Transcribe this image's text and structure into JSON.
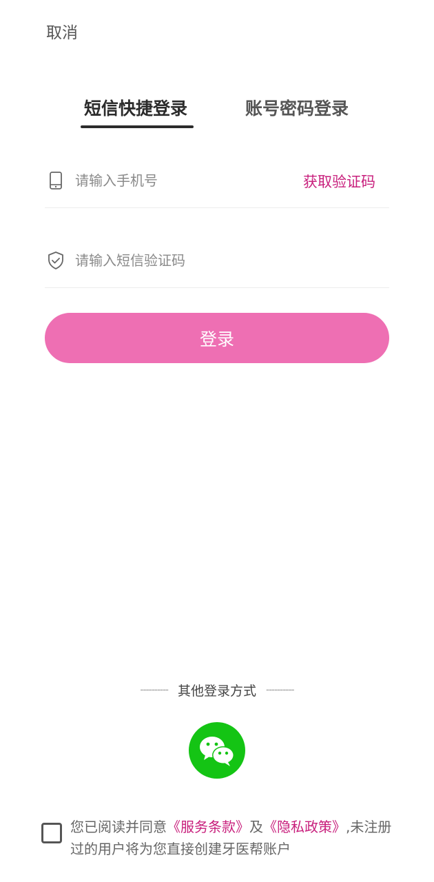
{
  "header": {
    "cancel_label": "取消"
  },
  "tabs": [
    {
      "label": "短信快捷登录",
      "active": true
    },
    {
      "label": "账号密码登录",
      "active": false
    }
  ],
  "phone_field": {
    "placeholder": "请输入手机号",
    "value": "",
    "icon": "phone-icon"
  },
  "code_field": {
    "placeholder": "请输入短信验证码",
    "value": "",
    "icon": "shield-check-icon"
  },
  "get_code_label": "获取验证码",
  "login_button_label": "登录",
  "other_login": {
    "dash_left": "----------",
    "label": "其他登录方式",
    "dash_right": "----------",
    "icon": "wechat-icon"
  },
  "agreement": {
    "checked": false,
    "prefix": "您已阅读并同意",
    "terms_link": "《服务条款》",
    "and": "及",
    "privacy_link": "《隐私政策》",
    "suffix": ",未注册过的用户将为您直接创建牙医帮账户"
  },
  "colors": {
    "accent": "#c81f7c",
    "button": "#ee6fb3",
    "wechat": "#14c414",
    "text": "#333333"
  }
}
